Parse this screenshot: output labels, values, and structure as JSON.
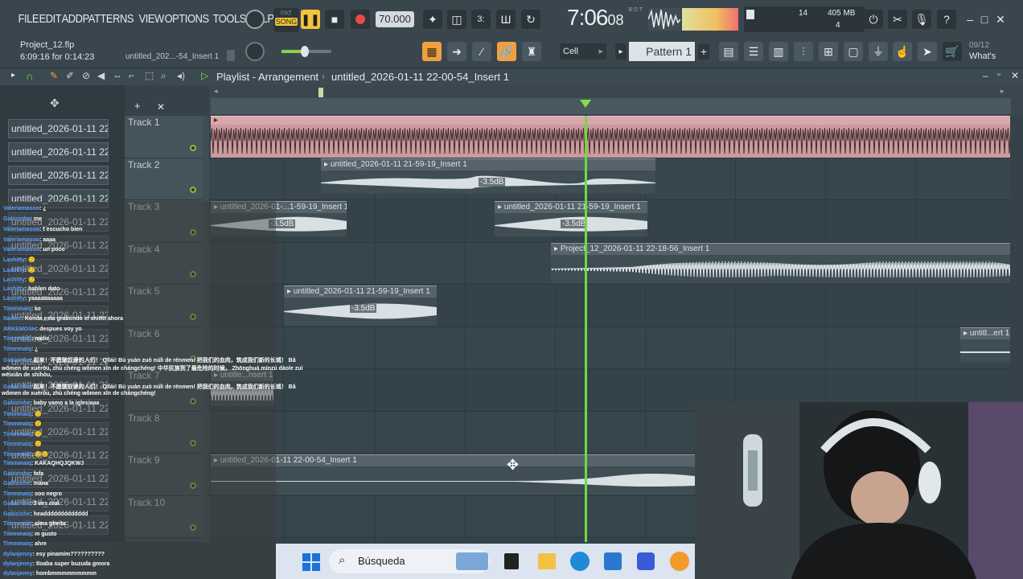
{
  "menu": [
    "FILE",
    "EDIT",
    "ADD",
    "PATTERNS",
    "VIEW",
    "OPTIONS",
    "TOOLS",
    "HELP"
  ],
  "transport": {
    "mode_top": "PAT",
    "mode_bottom": "SONG",
    "tempo": "70.000",
    "time": "7:06",
    "time_small": "08",
    "time_label": "B:S:T"
  },
  "meters": {
    "cpu_num": "14",
    "mem": "405 MB",
    "poly": "4"
  },
  "project": {
    "file": "Project_12.flp",
    "position": "6:09:16 for 0:14:23",
    "hint": "untitled_202...-54_Insert 1"
  },
  "snap": "Cell",
  "pattern": "Pattern 1",
  "news": {
    "date": "09/12",
    "label": "What's"
  },
  "playlist": {
    "title": "Playlist - Arrangement",
    "path": "untitled_2026-01-11 22-00-54_Insert 1"
  },
  "tracks": [
    "Track 1",
    "Track 2",
    "Track 3",
    "Track 4",
    "Track 5",
    "Track 6",
    "Track 7",
    "Track 8",
    "Track 9",
    "Track 10"
  ],
  "picker_label": "untitled_2026-01-11 22-...",
  "clips": {
    "t2": "untitled_2026-01-11 21-59-19_Insert 1",
    "t3a": "untitled_2026-01-...1-59-19_Insert 1",
    "t3b": "untitled_2026-01-11 21-59-19_Insert 1",
    "t4": "Project_12_2026-01-11 22-18-56_Insert 1",
    "t5": "untitled_2026-01-11 21-59-19_Insert 1",
    "t6": "untitl...ert 1",
    "t7": "untitle...nsert 1",
    "t9": "untitled_2026-01-11 22-00-54_Insert 1",
    "gain": "-3.5dB"
  },
  "chat": [
    {
      "u": "Valeriamasoo",
      "m": ": ¿"
    },
    {
      "u": "Gabizinhe",
      "m": ": me"
    },
    {
      "u": "Valeriamasoo",
      "m": ": t escucho bien"
    },
    {
      "u": "Valeriamasoo",
      "m": ": aaaa"
    },
    {
      "u": "Valeriamasoo",
      "m": ": un poco"
    },
    {
      "u": "Lashitty",
      "m": ": 🙂"
    },
    {
      "u": "Lashitty",
      "m": ": 🙂"
    },
    {
      "u": "Lashitty",
      "m": ": 🙂"
    },
    {
      "u": "Lashitty",
      "m": ": hablen dato"
    },
    {
      "u": "Lashitty",
      "m": ": yaaaaaaaaaa"
    },
    {
      "u": "Timmmaiq",
      "m": ": ke"
    },
    {
      "u": "Nadwe",
      "m": ": Konda esta grabondo el shitttt ahora"
    },
    {
      "u": "ARKEMOSH",
      "m": ": despues voy yo"
    },
    {
      "u": "Timmmaiq",
      "m": ": nadie"
    },
    {
      "u": "Timmmaiq",
      "m": ": ¿"
    },
    {
      "u": "Gabizinhe",
      "m": ": 起来！不愿做奴隶的人们！ Qǐlái! Bù yuàn zuò núlì de rénmen! 把我们的血肉，筑成我们新的长城！ Bǎ"
    },
    {
      "u": "",
      "m": "wǒmen de xuèròu, zhù chéng wǒmen xīn de chángchéng! 中华民族到了最危险的时候， Zhōnghuá mínzú dàole zuì"
    },
    {
      "u": "",
      "m": "wēixiǎn de shíhòu,"
    },
    {
      "u": "Gabizinhe",
      "m": ": 起来！不愿做奴隶的人们！ Qǐlái! Bù yuàn zuò núlì de rénmen! 把我们的血肉，筑成我们新的长城！ Bǎ"
    },
    {
      "u": "",
      "m": "wǒmen de xuèròu, zhù chéng wǒmen xīn de chángchéng!"
    },
    {
      "u": "Gabizinhe",
      "m": ": baby vamo a la iglesiaaa"
    },
    {
      "u": "Timmmaiq",
      "m": ": 🙂"
    },
    {
      "u": "Timmmaiq",
      "m": ": 🙂"
    },
    {
      "u": "Timmmaiq",
      "m": ": 🙂"
    },
    {
      "u": "Timmmaiq",
      "m": ": 🙂"
    },
    {
      "u": "Timmmaiq",
      "m": ": 😊😊"
    },
    {
      "u": "Timmmaiq",
      "m": ": KAKAQHQJQKWJ"
    },
    {
      "u": "Gabizinhe",
      "m": ": fafa"
    },
    {
      "u": "Gabizinhe",
      "m": ": mana"
    },
    {
      "u": "Timmmaiq",
      "m": ": soo negro"
    },
    {
      "u": "Gabizinhe",
      "m": ": 3 ees real"
    },
    {
      "u": "Gabizinhe",
      "m": ": headdddddddddddd"
    },
    {
      "u": "Timmmaiq",
      "m": ": alma gheita"
    },
    {
      "u": "Timmmaiq",
      "m": ": m gusto"
    },
    {
      "u": "Timmmaiq",
      "m": ": ahre"
    },
    {
      "u": "dylanjenny",
      "m": ": esy pinamim??????????"
    },
    {
      "u": "dylanjenny",
      "m": ": tloaba super buzuda gmora"
    },
    {
      "u": "dylanjenny",
      "m": ": hombmmmmmmmmm"
    }
  ],
  "taskbar": {
    "search": "Búsqueda"
  }
}
